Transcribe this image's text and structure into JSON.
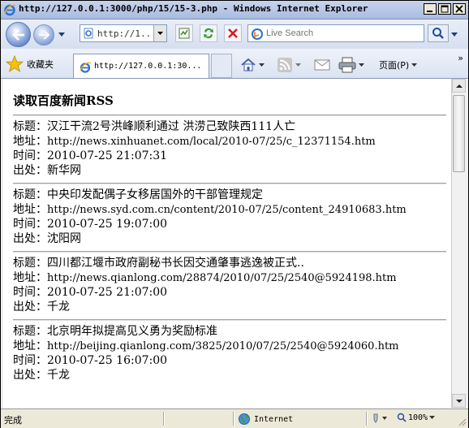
{
  "window": {
    "title": "http://127.0.0.1:3000/php/15/15-3.php - Windows Internet Explorer"
  },
  "navbar": {
    "address_value": "http://1...",
    "search_placeholder": "Live Search"
  },
  "favbar": {
    "favorites_label": "收藏夹",
    "tab_title": "http://127.0.0.1:30...",
    "page_menu_label": "页面(P)",
    "more_label": "»"
  },
  "page": {
    "heading": "读取百度新闻RSS",
    "labels": {
      "title": "标题：",
      "link": "地址：",
      "time": "时间：",
      "source": "出处："
    },
    "items": [
      {
        "title": "汉江干流2号洪峰顺利通过 洪涝己致陕西111人亡",
        "link": "http://news.xinhuanet.com/local/2010-07/25/c_12371154.htm",
        "time": "2010-07-25 21:07:31",
        "source": "新华网"
      },
      {
        "title": "中央印发配偶子女移居国外的干部管理规定",
        "link": "http://news.syd.com.cn/content/2010-07/25/content_24910683.htm",
        "time": "2010-07-25 19:07:00",
        "source": "沈阳网"
      },
      {
        "title": "四川都江堰市政府副秘书长因交通肇事逃逸被正式..",
        "link": "http://news.qianlong.com/28874/2010/07/25/2540@5924198.htm",
        "time": "2010-07-25 21:07:00",
        "source": "千龙"
      },
      {
        "title": "北京明年拟提高见义勇为奖励标准",
        "link": "http://beijing.qianlong.com/3825/2010/07/25/2540@5924060.htm",
        "time": "2010-07-25 16:07:00",
        "source": "千龙"
      }
    ]
  },
  "status": {
    "text": "完成",
    "zone": "Internet",
    "zoom": "100%"
  }
}
